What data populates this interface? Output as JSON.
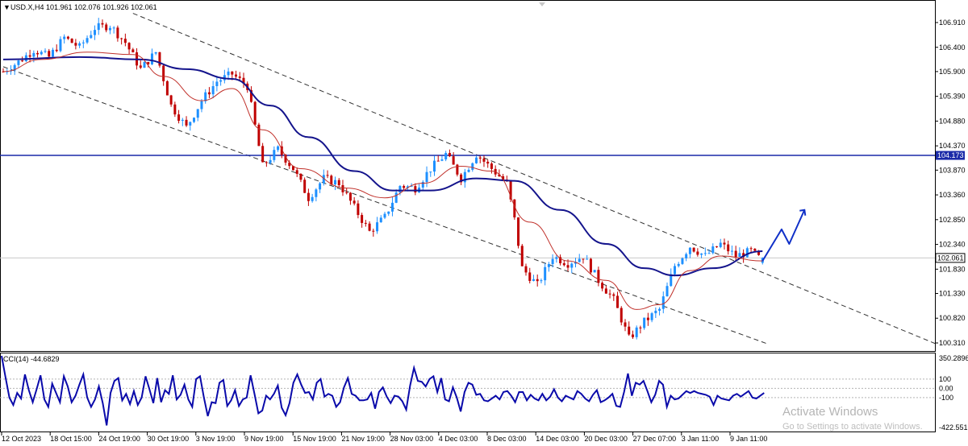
{
  "header": {
    "symbol_line": "USD.X,H4  101.961 102.076 101.926 102.061",
    "menu_marker": "▼"
  },
  "chart_data": {
    "type": "candlestick",
    "symbol": "USD.X",
    "timeframe": "H4",
    "ohlc_last": {
      "open": 101.961,
      "high": 102.076,
      "low": 101.926,
      "close": 102.061
    },
    "price_ticks": [
      "106.910",
      "106.400",
      "105.900",
      "105.390",
      "104.880",
      "104.370",
      "103.870",
      "103.360",
      "102.850",
      "102.340",
      "101.830",
      "101.330",
      "100.820",
      "100.310"
    ],
    "time_ticks": [
      "12 Oct 2023",
      "18 Oct 15:00",
      "24 Oct 19:00",
      "30 Oct 19:00",
      "3 Nov 19:00",
      "9 Nov 19:00",
      "15 Nov 19:00",
      "21 Nov 19:00",
      "28 Nov 03:00",
      "4 Dec 03:00",
      "8 Dec 03:00",
      "14 Dec 03:00",
      "20 Dec 03:00",
      "27 Dec 07:00",
      "3 Jan 11:00",
      "9 Jan 11:00"
    ],
    "ylim": [
      100.2,
      107.15
    ],
    "price_path": [
      [
        0,
        105.9
      ],
      [
        4,
        106.1
      ],
      [
        8,
        106.35
      ],
      [
        12,
        106.2
      ],
      [
        16,
        106.6
      ],
      [
        20,
        106.4
      ],
      [
        24,
        106.8
      ],
      [
        28,
        106.85
      ],
      [
        32,
        106.5
      ],
      [
        36,
        105.95
      ],
      [
        40,
        106.3
      ],
      [
        44,
        105.2
      ],
      [
        48,
        104.75
      ],
      [
        52,
        105.3
      ],
      [
        56,
        105.7
      ],
      [
        60,
        105.85
      ],
      [
        64,
        105.6
      ],
      [
        68,
        103.95
      ],
      [
        72,
        104.3
      ],
      [
        76,
        103.9
      ],
      [
        80,
        103.3
      ],
      [
        84,
        103.7
      ],
      [
        88,
        103.6
      ],
      [
        92,
        103.1
      ],
      [
        96,
        102.6
      ],
      [
        100,
        102.9
      ],
      [
        104,
        103.55
      ],
      [
        108,
        103.5
      ],
      [
        112,
        103.9
      ],
      [
        116,
        104.2
      ],
      [
        120,
        103.7
      ],
      [
        124,
        104.2
      ],
      [
        128,
        103.9
      ],
      [
        132,
        103.6
      ],
      [
        134,
        102.85
      ],
      [
        136,
        101.85
      ],
      [
        140,
        101.5
      ],
      [
        144,
        102.1
      ],
      [
        148,
        101.95
      ],
      [
        152,
        102.1
      ],
      [
        156,
        101.6
      ],
      [
        160,
        101.2
      ],
      [
        164,
        100.4
      ],
      [
        168,
        100.75
      ],
      [
        172,
        101.0
      ],
      [
        176,
        101.9
      ],
      [
        180,
        102.3
      ],
      [
        184,
        102.1
      ],
      [
        188,
        102.35
      ],
      [
        192,
        102.1
      ],
      [
        196,
        102.2
      ],
      [
        199,
        102.0
      ]
    ],
    "channel_upper": {
      "x": [
        34,
        300
      ],
      "price": [
        107.1,
        100.3
      ]
    },
    "channel_lower": {
      "x": [
        0,
        200
      ],
      "price": [
        106.0,
        100.3
      ]
    },
    "sma_fast_points": [
      [
        0,
        105.9
      ],
      [
        10,
        106.15
      ],
      [
        22,
        106.3
      ],
      [
        34,
        106.25
      ],
      [
        42,
        105.8
      ],
      [
        52,
        105.3
      ],
      [
        60,
        105.55
      ],
      [
        68,
        104.7
      ],
      [
        78,
        103.9
      ],
      [
        90,
        103.5
      ],
      [
        100,
        103.3
      ],
      [
        110,
        103.6
      ],
      [
        120,
        103.95
      ],
      [
        128,
        103.85
      ],
      [
        138,
        102.8
      ],
      [
        148,
        102.0
      ],
      [
        158,
        101.6
      ],
      [
        166,
        101.0
      ],
      [
        172,
        101.1
      ],
      [
        180,
        101.8
      ],
      [
        188,
        102.1
      ],
      [
        199,
        102.0
      ]
    ],
    "sma_slow_points": [
      [
        0,
        106.15
      ],
      [
        20,
        106.2
      ],
      [
        36,
        106.15
      ],
      [
        48,
        105.95
      ],
      [
        60,
        105.75
      ],
      [
        70,
        105.2
      ],
      [
        80,
        104.55
      ],
      [
        92,
        103.85
      ],
      [
        102,
        103.45
      ],
      [
        112,
        103.45
      ],
      [
        124,
        103.7
      ],
      [
        134,
        103.65
      ],
      [
        146,
        103.05
      ],
      [
        158,
        102.35
      ],
      [
        168,
        101.85
      ],
      [
        176,
        101.7
      ],
      [
        186,
        101.85
      ],
      [
        199,
        102.2
      ]
    ],
    "projection_points": [
      [
        199,
        102.0
      ],
      [
        204,
        102.65
      ],
      [
        206,
        102.35
      ],
      [
        210,
        103.05
      ]
    ],
    "hline_value": 104.173,
    "hline_label": "104.173",
    "current_price_label": "102.061",
    "annotations": [
      "104.173",
      "102.061"
    ],
    "indicator": {
      "name": "CCI(14) -44.6829",
      "scale_labels": [
        "350.2896",
        "100",
        "0.00",
        "-100",
        "-422.551"
      ],
      "ylim": [
        -422.551,
        350.2896
      ],
      "levels": [
        100,
        0,
        -100
      ],
      "values": [
        350,
        120,
        -100,
        -180,
        -50,
        -110,
        150,
        -20,
        -150,
        -10,
        140,
        -120,
        -200,
        50,
        -50,
        -150,
        130,
        20,
        -150,
        -80,
        40,
        150,
        -100,
        -200,
        -120,
        20,
        -160,
        -400,
        -50,
        80,
        110,
        -130,
        -60,
        -170,
        -30,
        -180,
        -100,
        130,
        -10,
        -160,
        110,
        -150,
        -20,
        -60,
        140,
        -120,
        -70,
        40,
        -120,
        -200,
        100,
        130,
        -100,
        -300,
        -150,
        -160,
        60,
        90,
        -190,
        -130,
        -20,
        -190,
        -120,
        -100,
        140,
        -60,
        -270,
        -240,
        -80,
        -120,
        -60,
        30,
        -210,
        -290,
        -160,
        60,
        150,
        40,
        -50,
        -40,
        -120,
        60,
        100,
        -90,
        -60,
        -80,
        -200,
        -150,
        10,
        110,
        -60,
        -80,
        -130,
        -130,
        -120,
        -50,
        -220,
        -40,
        10,
        -90,
        -160,
        -80,
        -90,
        -140,
        -230,
        30,
        220,
        80,
        70,
        20,
        100,
        130,
        -40,
        110,
        -120,
        -140,
        10,
        -100,
        -250,
        -40,
        60,
        40,
        -70,
        -60,
        -130,
        -140,
        -110,
        -80,
        -120,
        -40,
        -30,
        -80,
        -150,
        -40,
        -40,
        -130,
        -70,
        -110,
        -130,
        -60,
        -130,
        -90,
        -10,
        -100,
        -140,
        -80,
        -100,
        -120,
        -30,
        -60,
        -110,
        -140,
        -70,
        -20,
        -150,
        -130,
        -100,
        -60,
        -190,
        -200,
        -40,
        160,
        -80,
        60,
        40,
        80,
        -30,
        -150,
        -70,
        80,
        40,
        -200,
        -80,
        -120,
        -110,
        -70,
        -30,
        -50,
        -30,
        -50,
        -60,
        -70,
        -90,
        -180,
        -80,
        -110,
        -120,
        -130,
        -80,
        -60,
        -90,
        -60,
        -30,
        -100,
        -110,
        -80,
        -50
      ]
    }
  },
  "watermark": {
    "line1": "Activate Windows",
    "line2": "Go to Settings to activate Windows."
  },
  "colors": {
    "bull": "#1e90ff",
    "bear": "#c00000",
    "sma_fast": "#c0302a",
    "sma_slow": "#14148c",
    "hline": "#1a2aa8",
    "projection": "#1030c8",
    "cci": "#0a0aaa",
    "channel": "#333333"
  }
}
